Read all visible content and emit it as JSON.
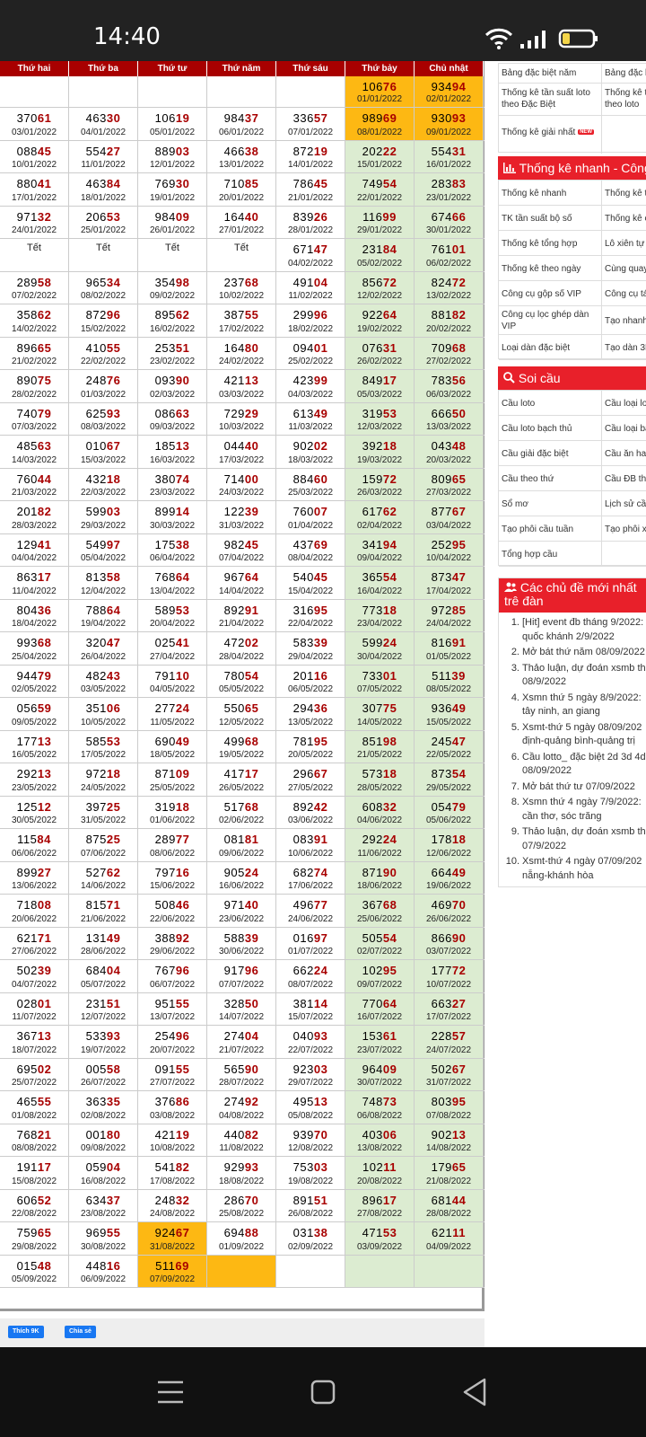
{
  "status": {
    "time": "14:40"
  },
  "table": {
    "headers": [
      "Thứ hai",
      "Thứ ba",
      "Thứ tư",
      "Thứ năm",
      "Thứ sáu",
      "Thứ bảy",
      "Chủ nhật"
    ],
    "rows": [
      [
        null,
        null,
        null,
        null,
        null,
        [
          "10676",
          "01/01/2022"
        ],
        [
          "93494",
          "02/01/2022"
        ]
      ],
      [
        [
          "37061",
          "03/01/2022"
        ],
        [
          "46330",
          "04/01/2022"
        ],
        [
          "10619",
          "05/01/2022"
        ],
        [
          "98437",
          "06/01/2022"
        ],
        [
          "33657",
          "07/01/2022"
        ],
        [
          "98969",
          "08/01/2022"
        ],
        [
          "93093",
          "09/01/2022"
        ]
      ],
      [
        [
          "08845",
          "10/01/2022"
        ],
        [
          "55427",
          "11/01/2022"
        ],
        [
          "88903",
          "12/01/2022"
        ],
        [
          "46638",
          "13/01/2022"
        ],
        [
          "87219",
          "14/01/2022"
        ],
        [
          "20222",
          "15/01/2022"
        ],
        [
          "55431",
          "16/01/2022"
        ]
      ],
      [
        [
          "88041",
          "17/01/2022"
        ],
        [
          "46384",
          "18/01/2022"
        ],
        [
          "76930",
          "19/01/2022"
        ],
        [
          "71085",
          "20/01/2022"
        ],
        [
          "78645",
          "21/01/2022"
        ],
        [
          "74954",
          "22/01/2022"
        ],
        [
          "28383",
          "23/01/2022"
        ]
      ],
      [
        [
          "97132",
          "24/01/2022"
        ],
        [
          "20653",
          "25/01/2022"
        ],
        [
          "98409",
          "26/01/2022"
        ],
        [
          "16440",
          "27/01/2022"
        ],
        [
          "83926",
          "28/01/2022"
        ],
        [
          "11699",
          "29/01/2022"
        ],
        [
          "67466",
          "30/01/2022"
        ]
      ],
      [
        "Tết",
        "Tết",
        "Tết",
        "Tết",
        [
          "67147",
          "04/02/2022"
        ],
        [
          "23184",
          "05/02/2022"
        ],
        [
          "76101",
          "06/02/2022"
        ]
      ],
      [
        [
          "28958",
          "07/02/2022"
        ],
        [
          "96534",
          "08/02/2022"
        ],
        [
          "35498",
          "09/02/2022"
        ],
        [
          "23768",
          "10/02/2022"
        ],
        [
          "49104",
          "11/02/2022"
        ],
        [
          "85672",
          "12/02/2022"
        ],
        [
          "82472",
          "13/02/2022"
        ]
      ],
      [
        [
          "35862",
          "14/02/2022"
        ],
        [
          "87296",
          "15/02/2022"
        ],
        [
          "89562",
          "16/02/2022"
        ],
        [
          "38755",
          "17/02/2022"
        ],
        [
          "29996",
          "18/02/2022"
        ],
        [
          "92264",
          "19/02/2022"
        ],
        [
          "88182",
          "20/02/2022"
        ]
      ],
      [
        [
          "89665",
          "21/02/2022"
        ],
        [
          "41055",
          "22/02/2022"
        ],
        [
          "25351",
          "23/02/2022"
        ],
        [
          "16480",
          "24/02/2022"
        ],
        [
          "09401",
          "25/02/2022"
        ],
        [
          "07631",
          "26/02/2022"
        ],
        [
          "70968",
          "27/02/2022"
        ]
      ],
      [
        [
          "89075",
          "28/02/2022"
        ],
        [
          "24876",
          "01/03/2022"
        ],
        [
          "09390",
          "02/03/2022"
        ],
        [
          "42113",
          "03/03/2022"
        ],
        [
          "42399",
          "04/03/2022"
        ],
        [
          "84917",
          "05/03/2022"
        ],
        [
          "78356",
          "06/03/2022"
        ]
      ],
      [
        [
          "74079",
          "07/03/2022"
        ],
        [
          "62593",
          "08/03/2022"
        ],
        [
          "08663",
          "09/03/2022"
        ],
        [
          "72929",
          "10/03/2022"
        ],
        [
          "61349",
          "11/03/2022"
        ],
        [
          "31953",
          "12/03/2022"
        ],
        [
          "66650",
          "13/03/2022"
        ]
      ],
      [
        [
          "48563",
          "14/03/2022"
        ],
        [
          "01067",
          "15/03/2022"
        ],
        [
          "18513",
          "16/03/2022"
        ],
        [
          "04440",
          "17/03/2022"
        ],
        [
          "90202",
          "18/03/2022"
        ],
        [
          "39218",
          "19/03/2022"
        ],
        [
          "04348",
          "20/03/2022"
        ]
      ],
      [
        [
          "76044",
          "21/03/2022"
        ],
        [
          "43218",
          "22/03/2022"
        ],
        [
          "38074",
          "23/03/2022"
        ],
        [
          "71400",
          "24/03/2022"
        ],
        [
          "88460",
          "25/03/2022"
        ],
        [
          "15972",
          "26/03/2022"
        ],
        [
          "80965",
          "27/03/2022"
        ]
      ],
      [
        [
          "20182",
          "28/03/2022"
        ],
        [
          "59903",
          "29/03/2022"
        ],
        [
          "89914",
          "30/03/2022"
        ],
        [
          "12239",
          "31/03/2022"
        ],
        [
          "76007",
          "01/04/2022"
        ],
        [
          "61762",
          "02/04/2022"
        ],
        [
          "87767",
          "03/04/2022"
        ]
      ],
      [
        [
          "12941",
          "04/04/2022"
        ],
        [
          "54997",
          "05/04/2022"
        ],
        [
          "17538",
          "06/04/2022"
        ],
        [
          "98245",
          "07/04/2022"
        ],
        [
          "43769",
          "08/04/2022"
        ],
        [
          "34194",
          "09/04/2022"
        ],
        [
          "25295",
          "10/04/2022"
        ]
      ],
      [
        [
          "86317",
          "11/04/2022"
        ],
        [
          "81358",
          "12/04/2022"
        ],
        [
          "76864",
          "13/04/2022"
        ],
        [
          "96764",
          "14/04/2022"
        ],
        [
          "54045",
          "15/04/2022"
        ],
        [
          "36554",
          "16/04/2022"
        ],
        [
          "87347",
          "17/04/2022"
        ]
      ],
      [
        [
          "80436",
          "18/04/2022"
        ],
        [
          "78864",
          "19/04/2022"
        ],
        [
          "58953",
          "20/04/2022"
        ],
        [
          "89291",
          "21/04/2022"
        ],
        [
          "31695",
          "22/04/2022"
        ],
        [
          "77318",
          "23/04/2022"
        ],
        [
          "97285",
          "24/04/2022"
        ]
      ],
      [
        [
          "99368",
          "25/04/2022"
        ],
        [
          "32047",
          "26/04/2022"
        ],
        [
          "02541",
          "27/04/2022"
        ],
        [
          "47202",
          "28/04/2022"
        ],
        [
          "58339",
          "29/04/2022"
        ],
        [
          "59924",
          "30/04/2022"
        ],
        [
          "81691",
          "01/05/2022"
        ]
      ],
      [
        [
          "94479",
          "02/05/2022"
        ],
        [
          "48243",
          "03/05/2022"
        ],
        [
          "79110",
          "04/05/2022"
        ],
        [
          "78054",
          "05/05/2022"
        ],
        [
          "20116",
          "06/05/2022"
        ],
        [
          "73301",
          "07/05/2022"
        ],
        [
          "51139",
          "08/05/2022"
        ]
      ],
      [
        [
          "05659",
          "09/05/2022"
        ],
        [
          "35106",
          "10/05/2022"
        ],
        [
          "27724",
          "11/05/2022"
        ],
        [
          "55065",
          "12/05/2022"
        ],
        [
          "29436",
          "13/05/2022"
        ],
        [
          "30775",
          "14/05/2022"
        ],
        [
          "93649",
          "15/05/2022"
        ]
      ],
      [
        [
          "17713",
          "16/05/2022"
        ],
        [
          "58553",
          "17/05/2022"
        ],
        [
          "69049",
          "18/05/2022"
        ],
        [
          "49968",
          "19/05/2022"
        ],
        [
          "78195",
          "20/05/2022"
        ],
        [
          "85198",
          "21/05/2022"
        ],
        [
          "24547",
          "22/05/2022"
        ]
      ],
      [
        [
          "29213",
          "23/05/2022"
        ],
        [
          "97218",
          "24/05/2022"
        ],
        [
          "87109",
          "25/05/2022"
        ],
        [
          "41717",
          "26/05/2022"
        ],
        [
          "29667",
          "27/05/2022"
        ],
        [
          "57318",
          "28/05/2022"
        ],
        [
          "87354",
          "29/05/2022"
        ]
      ],
      [
        [
          "12512",
          "30/05/2022"
        ],
        [
          "39725",
          "31/05/2022"
        ],
        [
          "31918",
          "01/06/2022"
        ],
        [
          "51768",
          "02/06/2022"
        ],
        [
          "89242",
          "03/06/2022"
        ],
        [
          "60832",
          "04/06/2022"
        ],
        [
          "05479",
          "05/06/2022"
        ]
      ],
      [
        [
          "11584",
          "06/06/2022"
        ],
        [
          "87525",
          "07/06/2022"
        ],
        [
          "28977",
          "08/06/2022"
        ],
        [
          "08181",
          "09/06/2022"
        ],
        [
          "08391",
          "10/06/2022"
        ],
        [
          "29224",
          "11/06/2022"
        ],
        [
          "17818",
          "12/06/2022"
        ]
      ],
      [
        [
          "89927",
          "13/06/2022"
        ],
        [
          "52762",
          "14/06/2022"
        ],
        [
          "79716",
          "15/06/2022"
        ],
        [
          "90524",
          "16/06/2022"
        ],
        [
          "68274",
          "17/06/2022"
        ],
        [
          "87190",
          "18/06/2022"
        ],
        [
          "66449",
          "19/06/2022"
        ]
      ],
      [
        [
          "71808",
          "20/06/2022"
        ],
        [
          "81571",
          "21/06/2022"
        ],
        [
          "50846",
          "22/06/2022"
        ],
        [
          "97140",
          "23/06/2022"
        ],
        [
          "49677",
          "24/06/2022"
        ],
        [
          "36768",
          "25/06/2022"
        ],
        [
          "46970",
          "26/06/2022"
        ]
      ],
      [
        [
          "62171",
          "27/06/2022"
        ],
        [
          "13149",
          "28/06/2022"
        ],
        [
          "38892",
          "29/06/2022"
        ],
        [
          "58839",
          "30/06/2022"
        ],
        [
          "01697",
          "01/07/2022"
        ],
        [
          "50554",
          "02/07/2022"
        ],
        [
          "86690",
          "03/07/2022"
        ]
      ],
      [
        [
          "50239",
          "04/07/2022"
        ],
        [
          "68404",
          "05/07/2022"
        ],
        [
          "76796",
          "06/07/2022"
        ],
        [
          "91796",
          "07/07/2022"
        ],
        [
          "66224",
          "08/07/2022"
        ],
        [
          "10295",
          "09/07/2022"
        ],
        [
          "17772",
          "10/07/2022"
        ]
      ],
      [
        [
          "02801",
          "11/07/2022"
        ],
        [
          "23151",
          "12/07/2022"
        ],
        [
          "95155",
          "13/07/2022"
        ],
        [
          "32850",
          "14/07/2022"
        ],
        [
          "38114",
          "15/07/2022"
        ],
        [
          "77064",
          "16/07/2022"
        ],
        [
          "66327",
          "17/07/2022"
        ]
      ],
      [
        [
          "36713",
          "18/07/2022"
        ],
        [
          "53393",
          "19/07/2022"
        ],
        [
          "25496",
          "20/07/2022"
        ],
        [
          "27404",
          "21/07/2022"
        ],
        [
          "04093",
          "22/07/2022"
        ],
        [
          "15361",
          "23/07/2022"
        ],
        [
          "22857",
          "24/07/2022"
        ]
      ],
      [
        [
          "69502",
          "25/07/2022"
        ],
        [
          "00558",
          "26/07/2022"
        ],
        [
          "09155",
          "27/07/2022"
        ],
        [
          "56590",
          "28/07/2022"
        ],
        [
          "92303",
          "29/07/2022"
        ],
        [
          "96409",
          "30/07/2022"
        ],
        [
          "50267",
          "31/07/2022"
        ]
      ],
      [
        [
          "46555",
          "01/08/2022"
        ],
        [
          "36335",
          "02/08/2022"
        ],
        [
          "37686",
          "03/08/2022"
        ],
        [
          "27492",
          "04/08/2022"
        ],
        [
          "49513",
          "05/08/2022"
        ],
        [
          "74873",
          "06/08/2022"
        ],
        [
          "80395",
          "07/08/2022"
        ]
      ],
      [
        [
          "76821",
          "08/08/2022"
        ],
        [
          "00180",
          "09/08/2022"
        ],
        [
          "42119",
          "10/08/2022"
        ],
        [
          "44082",
          "11/08/2022"
        ],
        [
          "93970",
          "12/08/2022"
        ],
        [
          "40306",
          "13/08/2022"
        ],
        [
          "90213",
          "14/08/2022"
        ]
      ],
      [
        [
          "19117",
          "15/08/2022"
        ],
        [
          "05904",
          "16/08/2022"
        ],
        [
          "54182",
          "17/08/2022"
        ],
        [
          "92993",
          "18/08/2022"
        ],
        [
          "75303",
          "19/08/2022"
        ],
        [
          "10211",
          "20/08/2022"
        ],
        [
          "17965",
          "21/08/2022"
        ]
      ],
      [
        [
          "60652",
          "22/08/2022"
        ],
        [
          "63437",
          "23/08/2022"
        ],
        [
          "24832",
          "24/08/2022"
        ],
        [
          "28670",
          "25/08/2022"
        ],
        [
          "89151",
          "26/08/2022"
        ],
        [
          "89617",
          "27/08/2022"
        ],
        [
          "68144",
          "28/08/2022"
        ]
      ],
      [
        [
          "75965",
          "29/08/2022"
        ],
        [
          "96955",
          "30/08/2022"
        ],
        [
          "92467",
          "31/08/2022"
        ],
        [
          "69488",
          "01/09/2022"
        ],
        [
          "03138",
          "02/09/2022"
        ],
        [
          "47153",
          "03/09/2022"
        ],
        [
          "62111",
          "04/09/2022"
        ]
      ],
      [
        [
          "01548",
          "05/09/2022"
        ],
        [
          "44816",
          "06/09/2022"
        ],
        [
          "51169",
          "07/09/2022"
        ],
        null,
        null,
        null,
        null
      ]
    ]
  },
  "facebook": {
    "like": "Thích 9K",
    "share": "Chia sẻ"
  },
  "sidebar": {
    "top_rows": [
      [
        "Bảng đặc biệt năm",
        "Bảng đặc b"
      ],
      [
        "Thống kê tần suất loto theo Đặc Biệt",
        "Thống kê t theo loto"
      ],
      [
        "Thống kê giải nhất",
        "NEW"
      ]
    ],
    "quick_title": "Thống kê nhanh - Công",
    "quick_rows": [
      [
        "Thống kê nhanh",
        "Thống kê t"
      ],
      [
        "TK tần suất bộ số",
        "Thống kê c"
      ],
      [
        "Thống kê tổng hợp",
        "Lô xiên tự"
      ],
      [
        "Thống kê theo ngày",
        "Cùng quay"
      ],
      [
        "Công cụ gộp số VIP",
        "Công cụ tá"
      ],
      [
        "Công cụ lọc ghép dàn VIP",
        "Tạo nhanh"
      ],
      [
        "Loại dàn đặc biệt",
        "Tạo dàn 3D"
      ]
    ],
    "soi_title": "Soi cầu",
    "soi_rows": [
      [
        "Cầu loto",
        "Cầu loại lo"
      ],
      [
        "Cầu loto bạch thủ",
        "Cầu loại ba"
      ],
      [
        "Cầu giải đặc biệt",
        "Cầu ăn hai"
      ],
      [
        "Cầu theo thứ",
        "Cầu ĐB the"
      ],
      [
        "Sổ mơ",
        "Lịch sử cầ"
      ],
      [
        "Tạo phôi cầu tuần",
        "Tạo phôi x"
      ],
      [
        "Tổng hợp cầu",
        ""
      ]
    ],
    "topics_title": "Các chủ đề mới nhất trê đàn",
    "topics": [
      [
        "1.",
        "[Hit] event đb tháng 9/2022:",
        "quốc khánh 2/9/2022"
      ],
      [
        "2.",
        "Mở bát thứ năm 08/09/2022",
        ""
      ],
      [
        "3.",
        "Thảo luận, dự đoán xsmb th",
        "08/9/2022"
      ],
      [
        "4.",
        "Xsmn thứ 5 ngày 8/9/2022:",
        "tây ninh, an giang"
      ],
      [
        "5.",
        "Xsmt-thứ 5 ngày 08/09/202",
        "định-quảng bình-quảng trị"
      ],
      [
        "6.",
        "Cầu lotto_ đặc biệt 2d 3d 4d",
        "08/09/2022"
      ],
      [
        "7.",
        "Mở bát thứ tư 07/09/2022",
        ""
      ],
      [
        "8.",
        "Xsmn thứ 4 ngày 7/9/2022:",
        "cần thơ, sóc trăng"
      ],
      [
        "9.",
        "Thảo luận, dự đoán xsmb th",
        "07/9/2022"
      ],
      [
        "10.",
        "Xsmt-thứ 4 ngày 07/09/202",
        "nẵng-khánh hòa"
      ]
    ]
  },
  "colors": {
    "header": "#a80000",
    "accent_red": "#e8202a",
    "weekend": "#dcecd1",
    "highlight": "#fdb813"
  },
  "icons": [
    "wifi-icon",
    "signal-icon",
    "battery-icon",
    "menu-icon",
    "home-icon",
    "back-icon",
    "chart-icon",
    "search-icon",
    "users-icon",
    "new-badge"
  ]
}
